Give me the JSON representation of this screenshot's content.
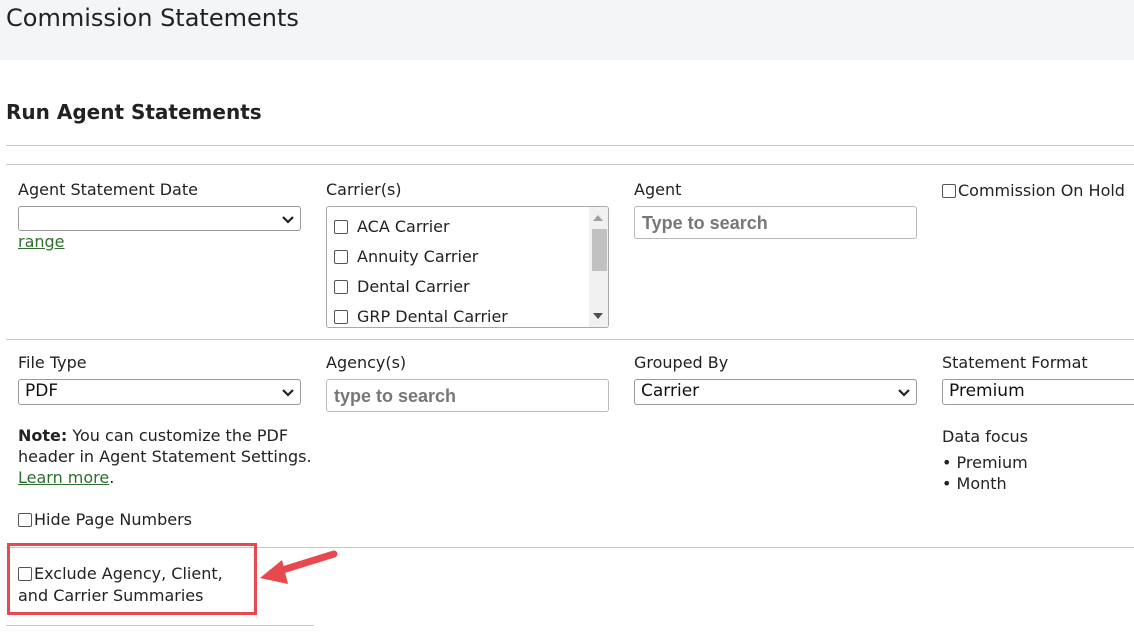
{
  "header": {
    "title": "Commission Statements"
  },
  "section": {
    "title": "Run Agent Statements"
  },
  "agent_statement_date": {
    "label": "Agent Statement Date",
    "value": "",
    "link": "range"
  },
  "carriers": {
    "label": "Carrier(s)",
    "items": [
      "ACA Carrier",
      "Annuity Carrier",
      "Dental Carrier",
      "GRP Dental Carrier"
    ]
  },
  "agent": {
    "label": "Agent",
    "placeholder": "Type to search"
  },
  "commission_on_hold": {
    "label": "Commission On Hold",
    "checked": false
  },
  "file_type": {
    "label": "File Type",
    "value": "PDF"
  },
  "note": {
    "bold": "Note:",
    "text": " You can customize the PDF header in Agent Statement Settings.",
    "link": "Learn more",
    "tail": "."
  },
  "hide_page_numbers": {
    "label": "Hide Page Numbers",
    "checked": false
  },
  "agencies": {
    "label": "Agency(s)",
    "placeholder": "type to search"
  },
  "grouped_by": {
    "label": "Grouped By",
    "value": "Carrier"
  },
  "statement_format": {
    "label": "Statement Format",
    "value": "Premium"
  },
  "data_focus": {
    "label": "Data focus",
    "items": [
      "Premium",
      "Month"
    ]
  },
  "exclude_summaries": {
    "label": "Exclude Agency, Client, and Carrier Summaries",
    "checked": false
  },
  "colors": {
    "highlight": "#e8494f",
    "link": "#2e6e2e",
    "topbar": "#f4f5f7"
  }
}
